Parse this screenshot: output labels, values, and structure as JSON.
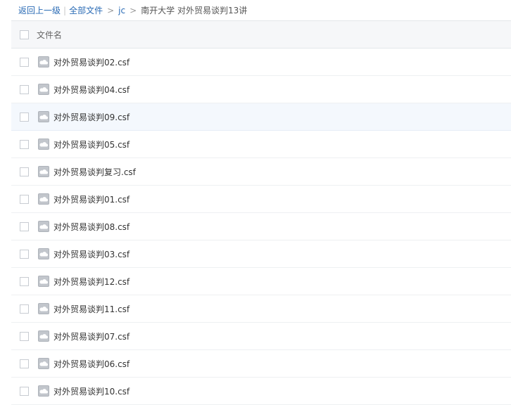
{
  "breadcrumb": {
    "back": "返回上一级",
    "all_files": "全部文件",
    "folder1": "jc",
    "current": "南开大学 对外贸易谈判13讲",
    "sep_bar": "|",
    "sep_gt": ">"
  },
  "file_list": {
    "header": "文件名",
    "items": [
      "对外贸易谈判02.csf",
      "对外贸易谈判04.csf",
      "对外贸易谈判09.csf",
      "对外贸易谈判05.csf",
      "对外贸易谈判复习.csf",
      "对外贸易谈判01.csf",
      "对外贸易谈判08.csf",
      "对外贸易谈判03.csf",
      "对外贸易谈判12.csf",
      "对外贸易谈判11.csf",
      "对外贸易谈判07.csf",
      "对外贸易谈判06.csf",
      "对外贸易谈判10.csf"
    ],
    "hovered_index": 2,
    "icon": "cloud-file-icon"
  },
  "colors": {
    "link": "#2a6bb5",
    "header_bg": "#f6f7f9",
    "hover_bg": "#f4f8fd",
    "icon_gray": "#b8bcc2"
  }
}
